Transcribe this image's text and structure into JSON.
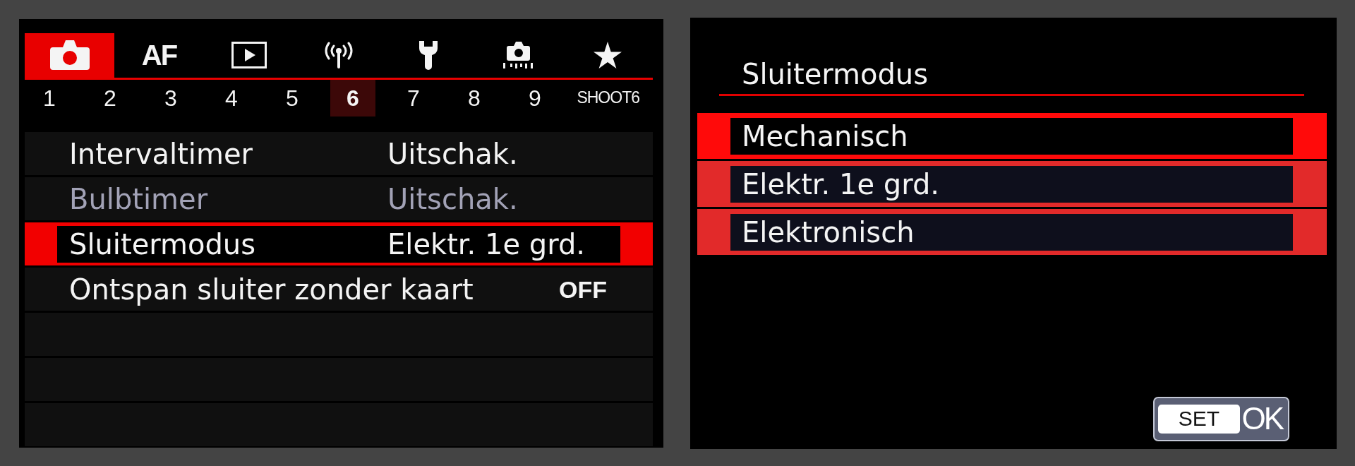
{
  "menu": {
    "tabs": [
      {
        "kind": "shoot",
        "selected": true
      },
      {
        "kind": "text",
        "label": "AF",
        "selected": false
      },
      {
        "kind": "playback",
        "selected": false
      },
      {
        "kind": "wireless",
        "selected": false
      },
      {
        "kind": "setup",
        "selected": false
      },
      {
        "kind": "custom",
        "selected": false
      },
      {
        "kind": "favorites",
        "selected": false
      }
    ],
    "pages": [
      {
        "label": "1",
        "selected": false
      },
      {
        "label": "2",
        "selected": false
      },
      {
        "label": "3",
        "selected": false
      },
      {
        "label": "4",
        "selected": false
      },
      {
        "label": "5",
        "selected": false
      },
      {
        "label": "6",
        "selected": true
      },
      {
        "label": "7",
        "selected": false
      },
      {
        "label": "8",
        "selected": false
      },
      {
        "label": "9",
        "selected": false
      }
    ],
    "page_title": "SHOOT6",
    "items": [
      {
        "kind": "option",
        "label": "Intervaltimer",
        "value": "Uitschak.",
        "disabled": false,
        "selected": false
      },
      {
        "kind": "option",
        "label": "Bulbtimer",
        "value": "Uitschak.",
        "disabled": true,
        "selected": false
      },
      {
        "kind": "option",
        "label": "Sluitermodus",
        "value": "Elektr. 1e grd.",
        "disabled": false,
        "selected": true
      },
      {
        "kind": "toggle",
        "label": "Ontspan sluiter zonder kaart",
        "value": "OFF",
        "disabled": false,
        "selected": false
      }
    ]
  },
  "dialog": {
    "title": "Sluitermodus",
    "options": [
      {
        "label": "Mechanisch",
        "selected": true
      },
      {
        "label": "Elektr. 1e grd.",
        "selected": false
      },
      {
        "label": "Elektronisch",
        "selected": false
      }
    ],
    "confirm": {
      "key": "SET",
      "label": "OK"
    }
  }
}
